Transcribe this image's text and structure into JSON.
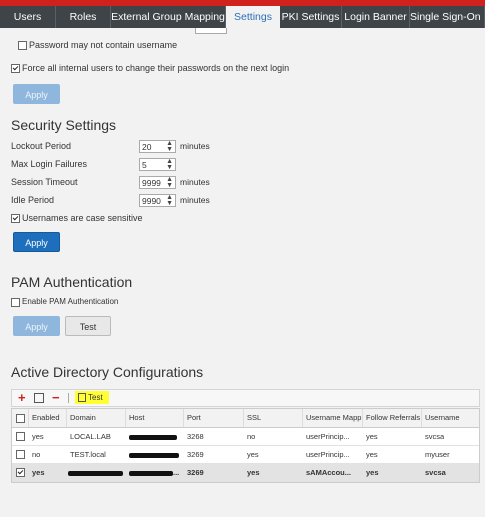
{
  "tabs": [
    {
      "label": "Users"
    },
    {
      "label": "Roles"
    },
    {
      "label": "External Group Mapping"
    },
    {
      "label": "Settings"
    },
    {
      "label": "PKI Settings"
    },
    {
      "label": "Login Banner"
    },
    {
      "label": "Single Sign-On Se"
    }
  ],
  "password": {
    "no_username_label": "Password may not contain username",
    "force_change_label": "Force all internal users to change their passwords on the next login",
    "apply_label": "Apply"
  },
  "security": {
    "title": "Security Settings",
    "lockout_label": "Lockout Period",
    "lockout_value": "20",
    "lockout_unit": "minutes",
    "max_fail_label": "Max Login Failures",
    "max_fail_value": "5",
    "session_label": "Session Timeout",
    "session_value": "9999",
    "session_unit": "minutes",
    "idle_label": "Idle Period",
    "idle_value": "9990",
    "idle_unit": "minutes",
    "case_label": "Usernames are case sensitive",
    "apply_label": "Apply"
  },
  "pam": {
    "title": "PAM Authentication",
    "enable_label": "Enable PAM Authentication",
    "apply_label": "Apply",
    "test_label": "Test"
  },
  "ad": {
    "title": "Active Directory Configurations",
    "test_label": "Test",
    "columns": [
      "Enabled",
      "Domain",
      "Host",
      "Port",
      "SSL",
      "Username Mapp",
      "Follow Referrals",
      "Username"
    ],
    "rows": [
      {
        "enabled": "yes",
        "domain": "LOCAL.LAB",
        "host": "",
        "port": "3268",
        "ssl": "no",
        "mapping": "userPrincip...",
        "referrals": "yes",
        "username": "svcsa"
      },
      {
        "enabled": "no",
        "domain": "TEST.local",
        "host": "",
        "port": "3269",
        "ssl": "yes",
        "mapping": "userPrincip...",
        "referrals": "yes",
        "username": "myuser"
      },
      {
        "enabled": "yes",
        "domain": "",
        "host": "...",
        "port": "3269",
        "ssl": "yes",
        "mapping": "sAMAccou...",
        "referrals": "yes",
        "username": "svcsa"
      }
    ]
  },
  "colors": {
    "accent": "#1d6fbe",
    "tabbar": "#3e4447",
    "highlight": "#ffff33"
  }
}
